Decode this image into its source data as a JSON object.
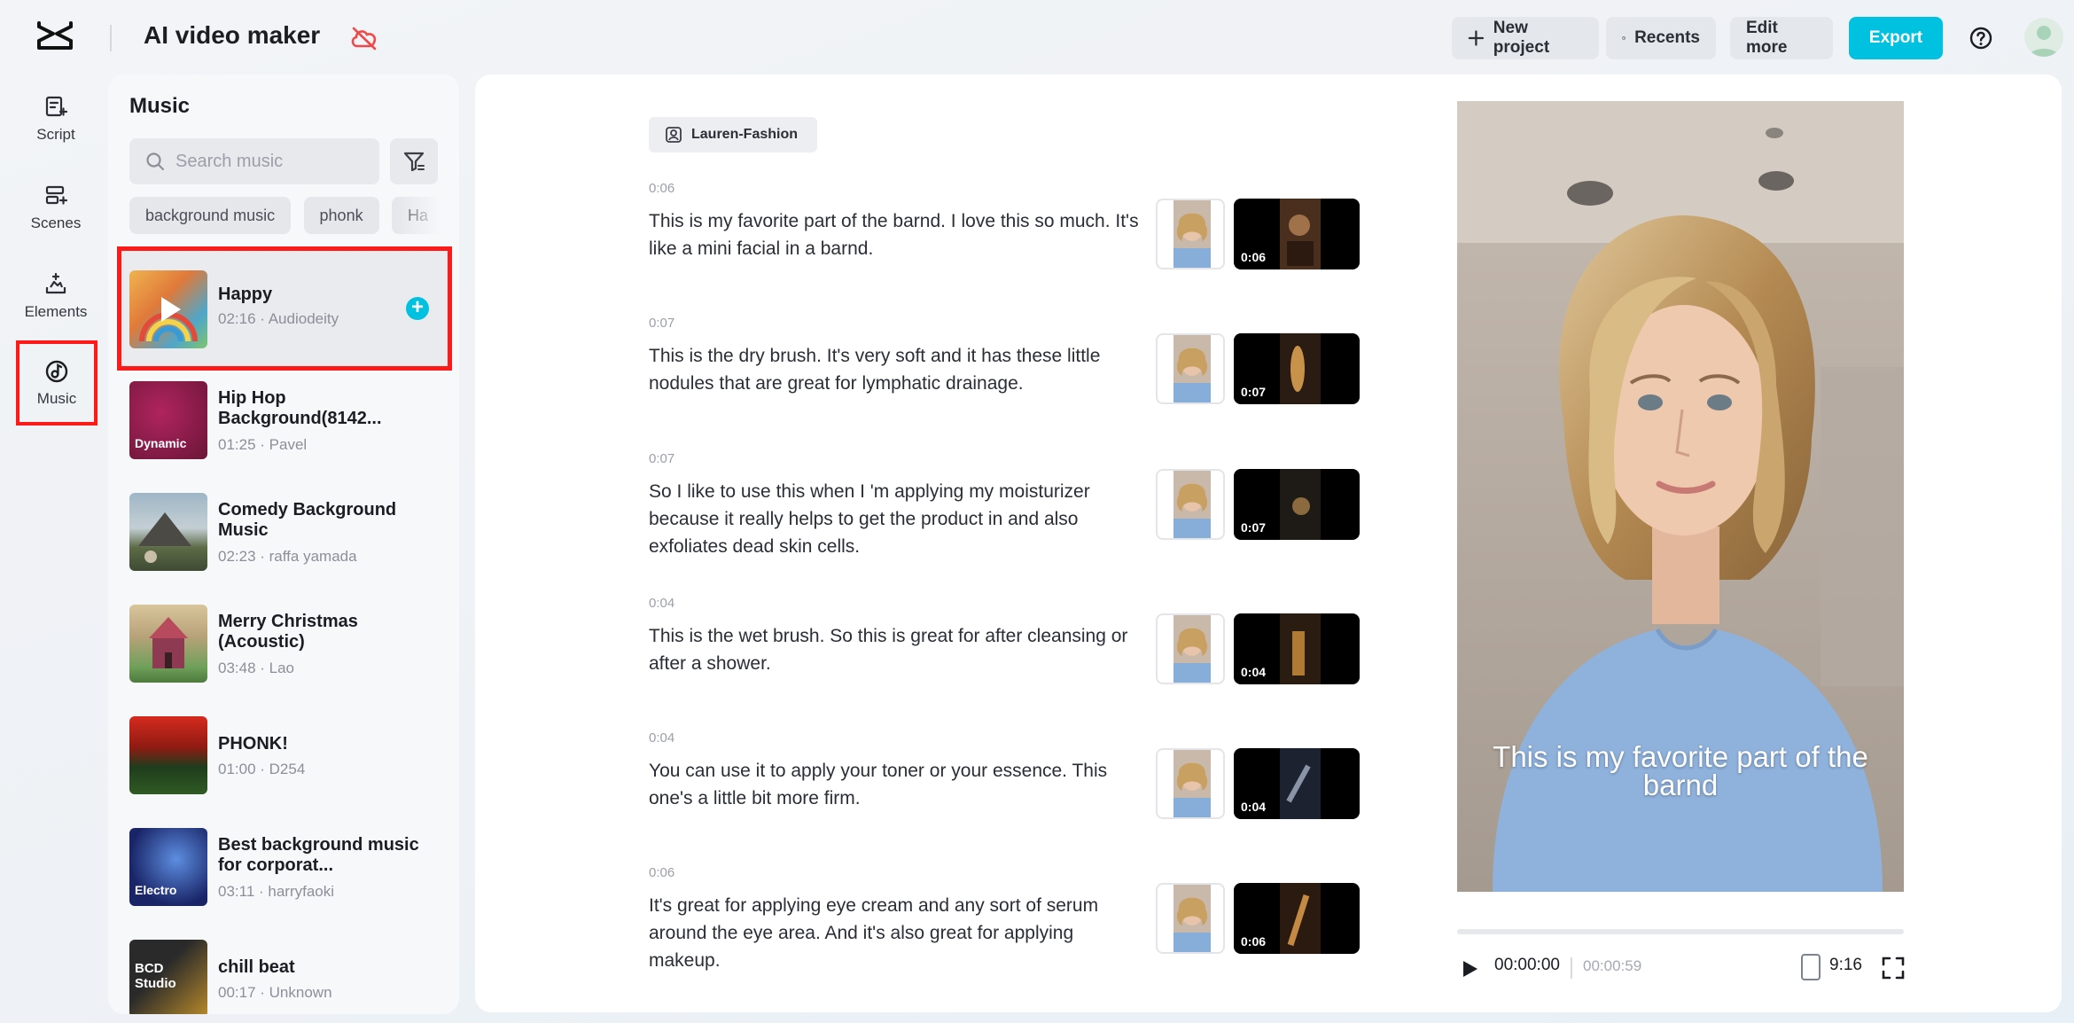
{
  "app": {
    "title": "AI video maker"
  },
  "toolbar": {
    "new_project": "New project",
    "recents": "Recents",
    "edit_more": "Edit more",
    "export": "Export"
  },
  "rail": {
    "items": [
      {
        "label": "Script",
        "icon": "script-icon"
      },
      {
        "label": "Scenes",
        "icon": "scenes-icon"
      },
      {
        "label": "Elements",
        "icon": "elements-icon"
      },
      {
        "label": "Music",
        "icon": "music-icon",
        "selected": true
      }
    ]
  },
  "music": {
    "title": "Music",
    "search_placeholder": "Search music",
    "chips": [
      "background music",
      "phonk",
      "Ha"
    ],
    "tracks": [
      {
        "name": "Happy",
        "meta": "02:16 · Audiodeity",
        "thumb_label": "",
        "selected": true,
        "colors": [
          "#e9a34a",
          "#4fa6c9"
        ]
      },
      {
        "name": "Hip Hop Background(8142...",
        "meta": "01:25 · Pavel",
        "thumb_label": "Dynamic",
        "colors": [
          "#8a1f4a",
          "#b0245e"
        ]
      },
      {
        "name": "Comedy Background Music",
        "meta": "02:23 · raffa yamada",
        "thumb_label": "",
        "colors": [
          "#8aa3b5",
          "#4d5a3c"
        ]
      },
      {
        "name": "Merry Christmas (Acoustic)",
        "meta": "03:48 · Lao",
        "thumb_label": "",
        "colors": [
          "#c9b08a",
          "#7c3a4e"
        ]
      },
      {
        "name": "PHONK!",
        "meta": "01:00 · D254",
        "thumb_label": "",
        "colors": [
          "#c4231c",
          "#1d3a1a"
        ]
      },
      {
        "name": "Best background music for corporat...",
        "meta": "03:11 · harryfaoki",
        "thumb_label": "Electro",
        "colors": [
          "#1c2b6e",
          "#4b7fd1"
        ]
      },
      {
        "name": "chill beat",
        "meta": "00:17 · Unknown",
        "thumb_label": "BCD Studio",
        "colors": [
          "#2a2a2a",
          "#b98a2a"
        ]
      }
    ]
  },
  "script": {
    "avatar_name": "Lauren-Fashion",
    "scenes": [
      {
        "time": "0:06",
        "text": "This is my favorite part of the barnd. I love this so much. It's like a mini facial in a barnd.",
        "duration": "0:06"
      },
      {
        "time": "0:07",
        "text": "This is the dry brush. It's very soft and it has these little nodules that are great for lymphatic drainage.",
        "duration": "0:07"
      },
      {
        "time": "0:07",
        "text": "So I like to use this when I 'm applying my moisturizer because it really helps to get the product in and also exfoliates dead skin cells.",
        "duration": "0:07"
      },
      {
        "time": "0:04",
        "text": "This is the wet brush. So this is great for after cleansing or after a shower.",
        "duration": "0:04"
      },
      {
        "time": "0:04",
        "text": "You can use it to apply your toner or your essence. This one's a little bit more firm.",
        "duration": "0:04"
      },
      {
        "time": "0:06",
        "text": "It's great for applying eye cream and any sort of serum around the eye area. And it's also great for applying makeup.",
        "duration": "0:06"
      }
    ]
  },
  "preview": {
    "caption": "This is my favorite part of the barnd",
    "current_time": "00:00:00",
    "total_time": "00:00:59",
    "ratio": "9:16",
    "progress": 0
  },
  "colors": {
    "accent": "#00c2e0",
    "highlight": "#ff1a1a"
  }
}
